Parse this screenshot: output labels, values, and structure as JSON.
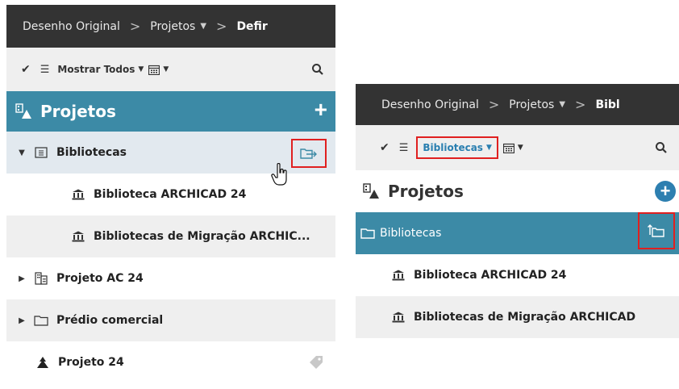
{
  "breadcrumb": {
    "root": "Desenho Original",
    "projects": "Projetos",
    "current_left": "Defir",
    "current_right": "Bibl"
  },
  "toolbar_left": {
    "filter_label": "Mostrar Todos"
  },
  "toolbar_right": {
    "filter_label": "Bibliotecas"
  },
  "header": {
    "title": "Projetos",
    "add_label": "+"
  },
  "tree_left": [
    {
      "label": "Bibliotecas"
    },
    {
      "label": "Biblioteca ARCHICAD 24"
    },
    {
      "label": "Bibliotecas de Migração ARCHIC..."
    },
    {
      "label": "Projeto AC 24"
    },
    {
      "label": "Prédio comercial"
    },
    {
      "label": "Projeto 24"
    }
  ],
  "tree_right": [
    {
      "label": "Bibliotecas"
    },
    {
      "label": "Biblioteca ARCHICAD 24"
    },
    {
      "label": "Bibliotecas de Migração ARCHICAD"
    }
  ],
  "colors": {
    "topbar": "#333333",
    "header_blue": "#3c8aa6",
    "highlight_red": "#e02020",
    "link_blue": "#2a7fb0"
  },
  "icons": [
    "checkmark-icon",
    "list-icon",
    "calendar-icon",
    "search-icon",
    "projects-icon",
    "library-folder-icon",
    "library-icon",
    "building-icon",
    "folder-icon",
    "project-icon",
    "tag-icon",
    "move-up-icon",
    "hand-cursor-icon"
  ]
}
